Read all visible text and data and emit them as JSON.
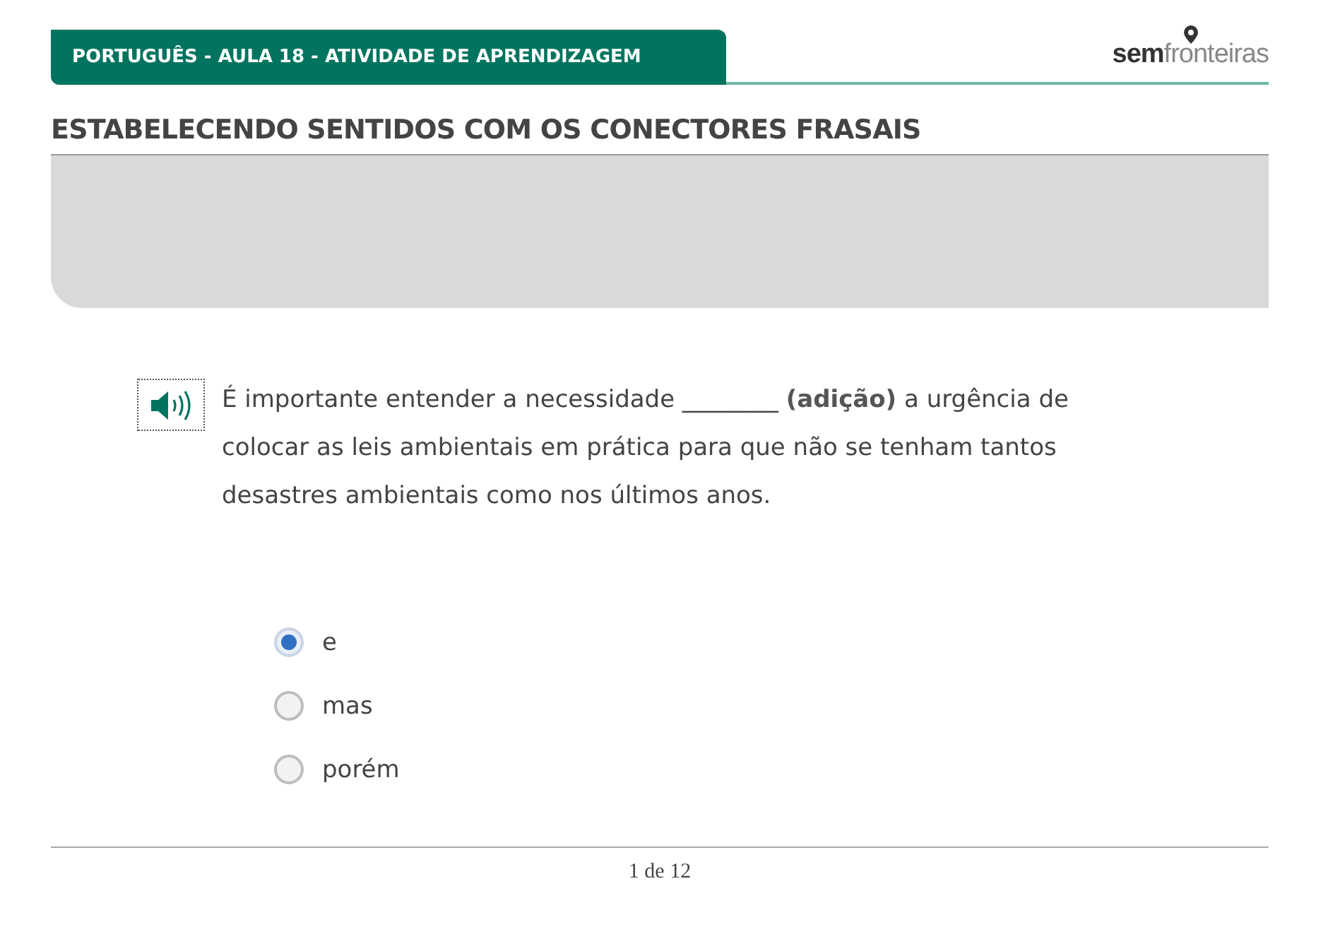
{
  "header": {
    "course": "PORTUGUÊS - AULA 18 - ATIVIDADE DE APRENDIZAGEM",
    "logo": {
      "bold": "sem",
      "light": "fronteiras"
    }
  },
  "title": "ESTABELECENDO SENTIDOS COM OS CONECTORES FRASAIS",
  "question": {
    "text": "É importante entender a necessidade ________ **(adição)** a urgência de colocar as leis ambientais em prática para que não se tenham tantos desastres ambientais como nos últimos anos."
  },
  "options": [
    {
      "label": "e",
      "selected": true
    },
    {
      "label": "mas",
      "selected": false
    },
    {
      "label": "porém",
      "selected": false
    }
  ],
  "pager": "1 de 12"
}
